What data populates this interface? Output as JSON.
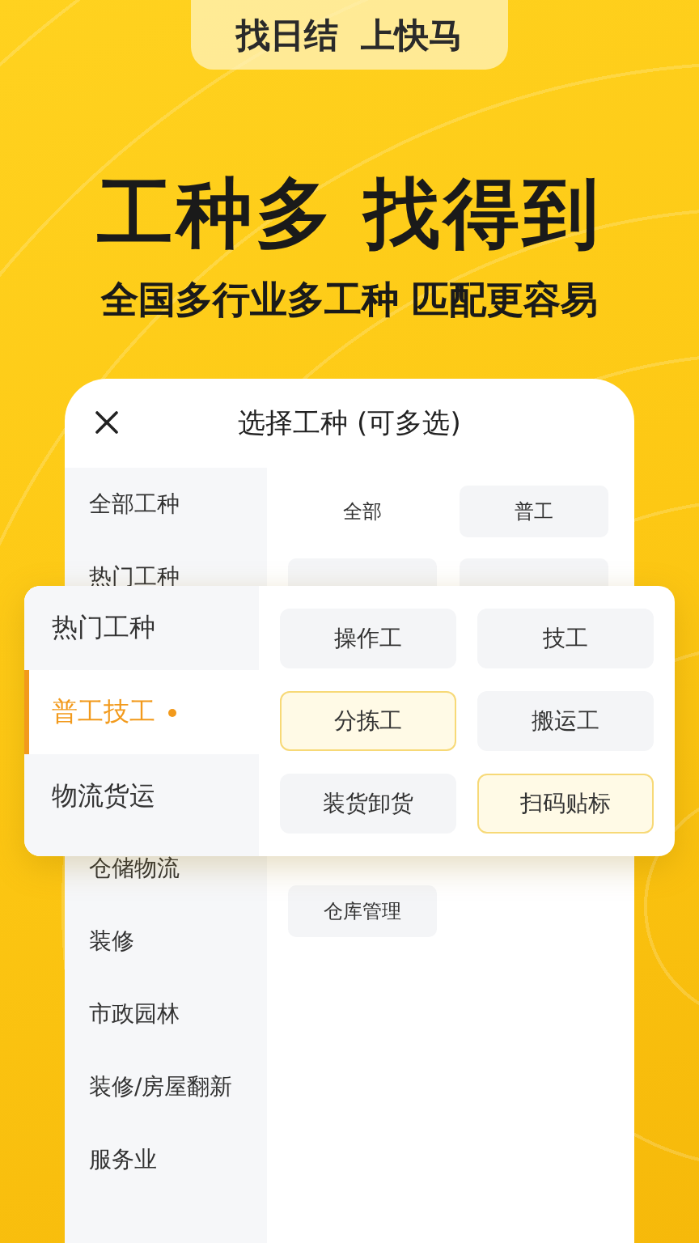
{
  "banner": {
    "words": [
      "找日结",
      "上快马"
    ]
  },
  "headline": "工种多 找得到",
  "subtitle": "全国多行业多工种 匹配更容易",
  "dialog": {
    "title": "选择工种 (可多选)",
    "categories_top": [
      {
        "label": "全部工种"
      },
      {
        "label": "热门工种"
      }
    ],
    "categories_bottom": [
      {
        "label": "仓储物流"
      },
      {
        "label": "装修"
      },
      {
        "label": "市政园林"
      },
      {
        "label": "装修/房屋翻新"
      },
      {
        "label": "服务业"
      }
    ],
    "options_top": [
      {
        "label": "全部",
        "kind": "plain"
      },
      {
        "label": "普工",
        "kind": "chip"
      }
    ],
    "options_bottom": [
      {
        "label": "仓库管理"
      }
    ]
  },
  "popup": {
    "categories": [
      {
        "label": "热门工种",
        "selected": false
      },
      {
        "label": "普工技工",
        "selected": true
      },
      {
        "label": "物流货运",
        "selected": false
      }
    ],
    "options": [
      {
        "label": "操作工",
        "selected": false
      },
      {
        "label": "技工",
        "selected": false
      },
      {
        "label": "分拣工",
        "selected": true
      },
      {
        "label": "搬运工",
        "selected": false
      },
      {
        "label": "装货卸货",
        "selected": false
      },
      {
        "label": "扫码贴标",
        "selected": true
      }
    ]
  }
}
